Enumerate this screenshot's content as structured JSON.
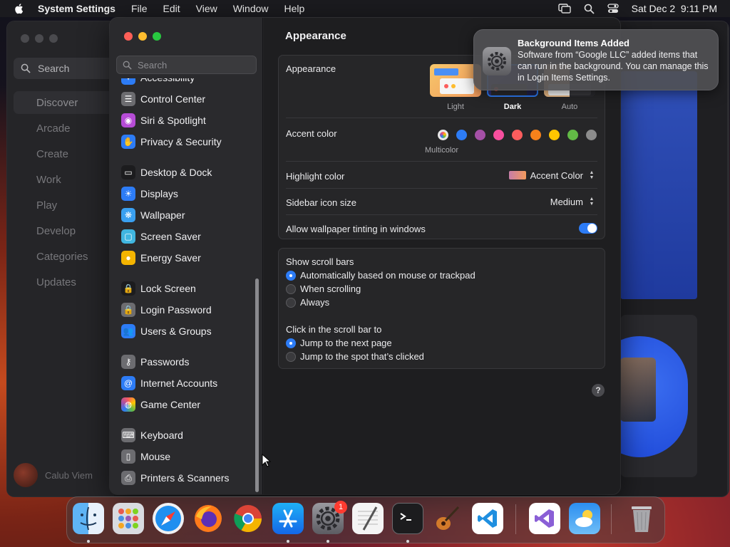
{
  "menubar": {
    "app_name": "System Settings",
    "menus": [
      "File",
      "Edit",
      "View",
      "Window",
      "Help"
    ],
    "clock": "Sat Dec 2  9:11 PM"
  },
  "appstore": {
    "search_placeholder": "Search",
    "nav": [
      "Discover",
      "Arcade",
      "Create",
      "Work",
      "Play",
      "Develop",
      "Categories",
      "Updates"
    ],
    "selected": "Discover",
    "user_name": "Calub Viem"
  },
  "settings": {
    "search_placeholder": "Search",
    "sidebar": [
      {
        "label": "Accessibility",
        "icon": "accessibility-icon",
        "color": "#2d7cf6"
      },
      {
        "label": "Control Center",
        "icon": "control-center-icon",
        "color": "#6c6c70"
      },
      {
        "label": "Siri & Spotlight",
        "icon": "siri-icon",
        "color": "#b64cd6"
      },
      {
        "label": "Privacy & Security",
        "icon": "hand-icon",
        "color": "#2d7cf6"
      },
      {
        "label": "Desktop & Dock",
        "icon": "desktop-dock-icon",
        "color": "#1c1c1e"
      },
      {
        "label": "Displays",
        "icon": "displays-icon",
        "color": "#2d7cf6"
      },
      {
        "label": "Wallpaper",
        "icon": "wallpaper-icon",
        "color": "#3aa0f0"
      },
      {
        "label": "Screen Saver",
        "icon": "screen-saver-icon",
        "color": "#40b6e0"
      },
      {
        "label": "Energy Saver",
        "icon": "energy-icon",
        "color": "#f4b400"
      },
      {
        "label": "Lock Screen",
        "icon": "lock-icon",
        "color": "#1c1c1e"
      },
      {
        "label": "Login Password",
        "icon": "password-lock-icon",
        "color": "#6c6c70"
      },
      {
        "label": "Users & Groups",
        "icon": "users-icon",
        "color": "#2d7cf6"
      },
      {
        "label": "Passwords",
        "icon": "key-icon",
        "color": "#6c6c70"
      },
      {
        "label": "Internet Accounts",
        "icon": "at-icon",
        "color": "#2d7cf6"
      },
      {
        "label": "Game Center",
        "icon": "game-center-icon",
        "color": "#e0e0e0"
      },
      {
        "label": "Keyboard",
        "icon": "keyboard-icon",
        "color": "#6c6c70"
      },
      {
        "label": "Mouse",
        "icon": "mouse-icon",
        "color": "#6c6c70"
      },
      {
        "label": "Printers & Scanners",
        "icon": "printer-icon",
        "color": "#6c6c70"
      }
    ],
    "title": "Appearance",
    "appearance": {
      "label": "Appearance",
      "options": [
        "Light",
        "Dark",
        "Auto"
      ],
      "selected": "Dark"
    },
    "accent": {
      "label": "Accent color",
      "caption": "Multicolor",
      "colors": [
        "multicolor",
        "#2d7cf6",
        "#a550a7",
        "#f74f9e",
        "#fc5d5d",
        "#f7821b",
        "#ffc600",
        "#62ba46",
        "#8c8c8c"
      ]
    },
    "highlight": {
      "label": "Highlight color",
      "value": "Accent Color"
    },
    "sidebar_icon": {
      "label": "Sidebar icon size",
      "value": "Medium"
    },
    "tinting": {
      "label": "Allow wallpaper tinting in windows",
      "enabled": true
    },
    "scroll_bars": {
      "label": "Show scroll bars",
      "options": [
        "Automatically based on mouse or trackpad",
        "When scrolling",
        "Always"
      ],
      "selected": 0
    },
    "click_scroll": {
      "label": "Click in the scroll bar to",
      "options": [
        "Jump to the next page",
        "Jump to the spot that’s clicked"
      ],
      "selected": 0
    },
    "help": "?"
  },
  "notification": {
    "title": "Background Items Added",
    "body": "Software from “Google LLC” added items that can run in the background. You can manage this in Login Items Settings."
  },
  "dock": {
    "apps": [
      "Finder",
      "Launchpad",
      "Safari",
      "Firefox",
      "Chrome",
      "App Store",
      "System Settings",
      "TextEdit",
      "Terminal",
      "GarageBand",
      "Visual Studio Code",
      "Visual Studio",
      "Weather",
      "Trash"
    ],
    "settings_badge": "1"
  }
}
